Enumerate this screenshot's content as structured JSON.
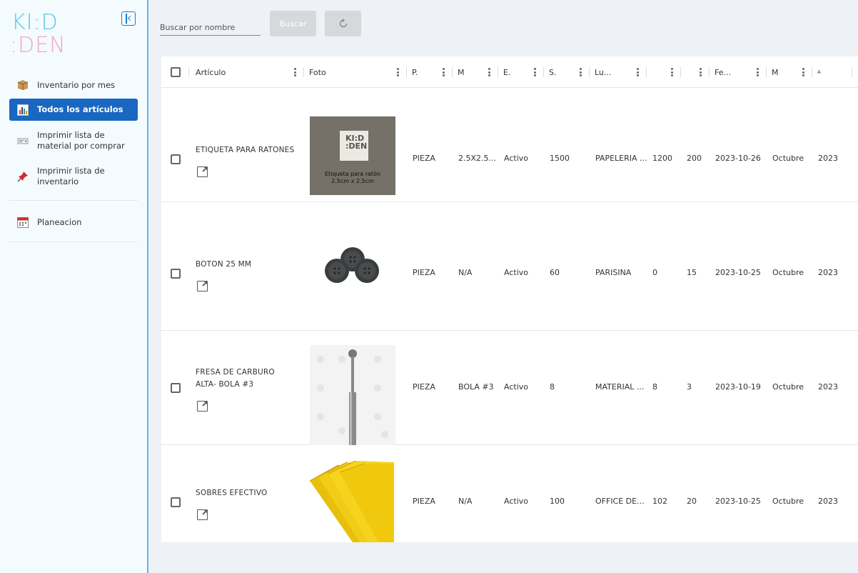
{
  "app": {
    "logo_line1": "KI:D",
    "logo_line2": ":DEN",
    "colors": {
      "accent": "#1967c0",
      "logo_blue": "#5fc7e4",
      "logo_pink": "#f2a4c4",
      "sidebar_border": "#5fb6dc"
    }
  },
  "sidebar": {
    "items": [
      {
        "label": "Inventario por mes",
        "icon": "box-icon"
      },
      {
        "label": "Todos los artículos",
        "icon": "bar-chart-icon",
        "active": true
      },
      {
        "label": "Imprimir lista de material por comprar",
        "icon": "receipt-icon"
      },
      {
        "label": "Imprimir lista de inventario",
        "icon": "pushpin-icon"
      },
      {
        "label": "Planeacion",
        "icon": "calendar-icon"
      }
    ]
  },
  "toolbar": {
    "search_placeholder": "Buscar por nombre",
    "search_label": "Buscar",
    "refresh_icon": "refresh-icon"
  },
  "table": {
    "columns": [
      "Artículo",
      "Foto",
      "P.",
      "M",
      "E.",
      "S.",
      "Lu...",
      "",
      "",
      "Fe...",
      "M",
      "A"
    ],
    "rows": [
      {
        "name_line1": "ETIQUETA PARA RATONES",
        "name_line2": "",
        "photo_text1": "Etiqueta para ratón",
        "photo_text2": "2.5cm x 2.5cm",
        "unit": "PIEZA",
        "measure": "2.5X2.5...",
        "status": "Activo",
        "stock": "1500",
        "place": "PAPELERIA ...",
        "n1": "1200",
        "n2": "200",
        "date": "2023-10-26",
        "month": "Octubre",
        "year": "2023"
      },
      {
        "name_line1": "BOTON 25 MM",
        "name_line2": "",
        "unit": "PIEZA",
        "measure": "N/A",
        "status": "Activo",
        "stock": "60",
        "place": "PARISINA",
        "n1": "0",
        "n2": "15",
        "date": "2023-10-25",
        "month": "Octubre",
        "year": "2023"
      },
      {
        "name_line1": "FRESA DE CARBURO",
        "name_line2": "ALTA- BOLA #3",
        "unit": "PIEZA",
        "measure": "BOLA #3",
        "status": "Activo",
        "stock": "8",
        "place": "MATERIAL ...",
        "n1": "8",
        "n2": "3",
        "date": "2023-10-19",
        "month": "Octubre",
        "year": "2023"
      },
      {
        "name_line1": "SOBRES EFECTIVO",
        "name_line2": "",
        "unit": "PIEZA",
        "measure": "N/A",
        "status": "Activo",
        "stock": "100",
        "place": "OFFICE DE...",
        "n1": "102",
        "n2": "20",
        "date": "2023-10-25",
        "month": "Octubre",
        "year": "2023"
      }
    ]
  }
}
